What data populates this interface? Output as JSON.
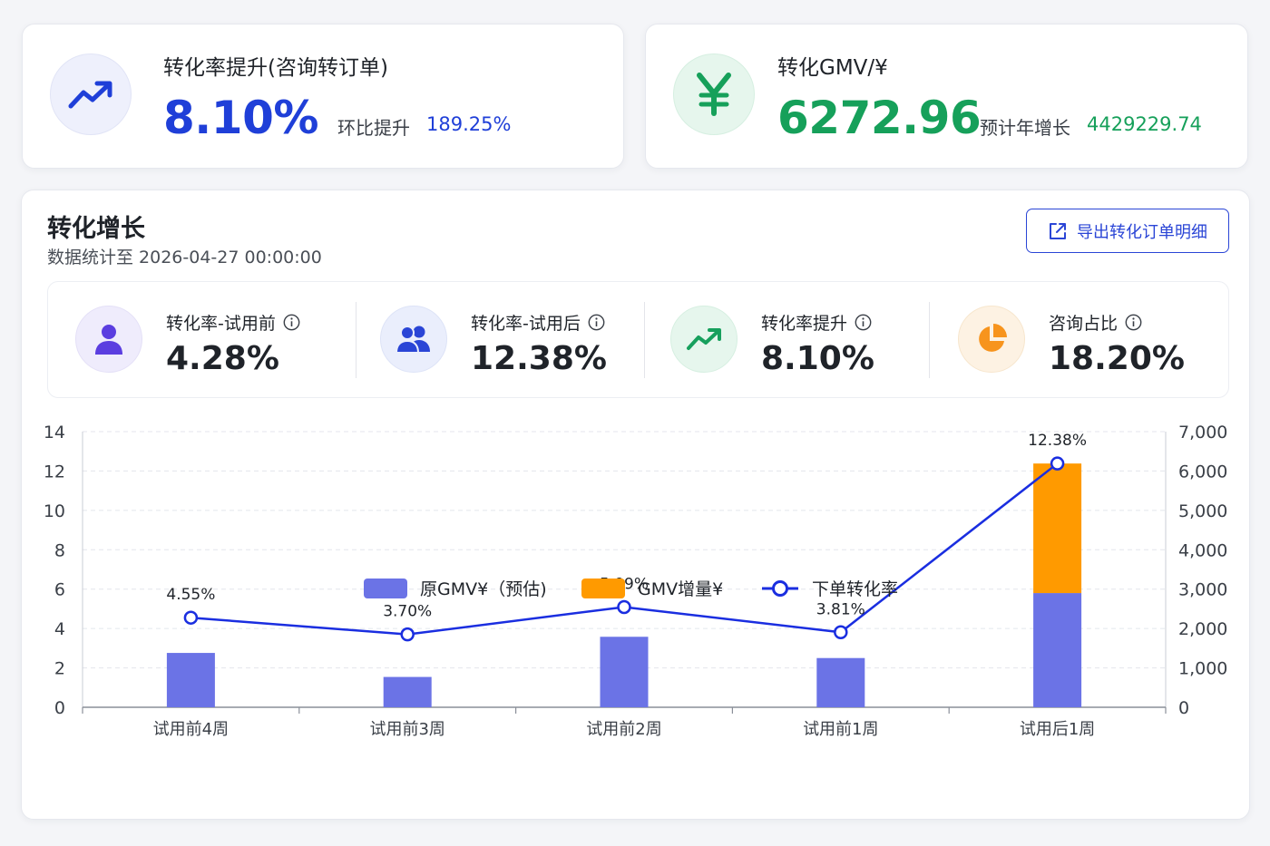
{
  "top_cards": {
    "rate": {
      "title": "转化率提升(咨询转订单)",
      "value": "8.10%",
      "sub_label": "环比提升",
      "sub_value": "189.25%",
      "icon": "trending-up-icon",
      "color": "#1f3fd8"
    },
    "gmv": {
      "title": "转化GMV/¥",
      "value": "6272.96",
      "sub_label": "预计年增长",
      "sub_value": "4429229.74",
      "icon": "yen-icon",
      "color": "#16a05a"
    }
  },
  "section": {
    "title": "转化增长",
    "subtitle": "数据统计至 2026-04-27 00:00:00",
    "export_label": "导出转化订单明细"
  },
  "kpis": [
    {
      "label": "转化率-试用前",
      "value": "4.28%",
      "icon": "user-icon",
      "color": "#5b3ee0"
    },
    {
      "label": "转化率-试用后",
      "value": "12.38%",
      "icon": "users-icon",
      "color": "#2a45d6"
    },
    {
      "label": "转化率提升",
      "value": "8.10%",
      "icon": "trending-up-icon",
      "color": "#17a05d"
    },
    {
      "label": "咨询占比",
      "value": "18.20%",
      "icon": "pie-chart-icon",
      "color": "#f7941d"
    }
  ],
  "chart_data": {
    "type": "bar",
    "categories": [
      "试用前4周",
      "试用前3周",
      "试用前2周",
      "试用前1周",
      "试用后1周"
    ],
    "series": [
      {
        "name": "原GMV¥（预估)",
        "type": "bar",
        "stack": "gmv",
        "axis": "right",
        "color": "#6b73e6",
        "values": [
          1380,
          770,
          1790,
          1250,
          2900
        ]
      },
      {
        "name": "GMV增量¥",
        "type": "bar",
        "stack": "gmv",
        "axis": "right",
        "color": "#ff9a00",
        "values": [
          0,
          0,
          0,
          0,
          3290
        ]
      },
      {
        "name": "下单转化率",
        "type": "line",
        "axis": "left",
        "color": "#1a2ee0",
        "values": [
          4.55,
          3.7,
          5.09,
          3.81,
          12.38
        ],
        "labels": [
          "4.55%",
          "3.70%",
          "5.09%",
          "3.81%",
          "12.38%"
        ]
      }
    ],
    "y_left": {
      "ticks": [
        "0",
        "2",
        "4",
        "6",
        "8",
        "10",
        "12",
        "14"
      ],
      "ylim": [
        0,
        14
      ]
    },
    "y_right": {
      "ticks": [
        "0",
        "1,000",
        "2,000",
        "3,000",
        "4,000",
        "5,000",
        "6,000",
        "7,000"
      ],
      "ylim": [
        0,
        7000
      ]
    },
    "line_scale": "left",
    "grid": true,
    "legend": "bottom"
  }
}
